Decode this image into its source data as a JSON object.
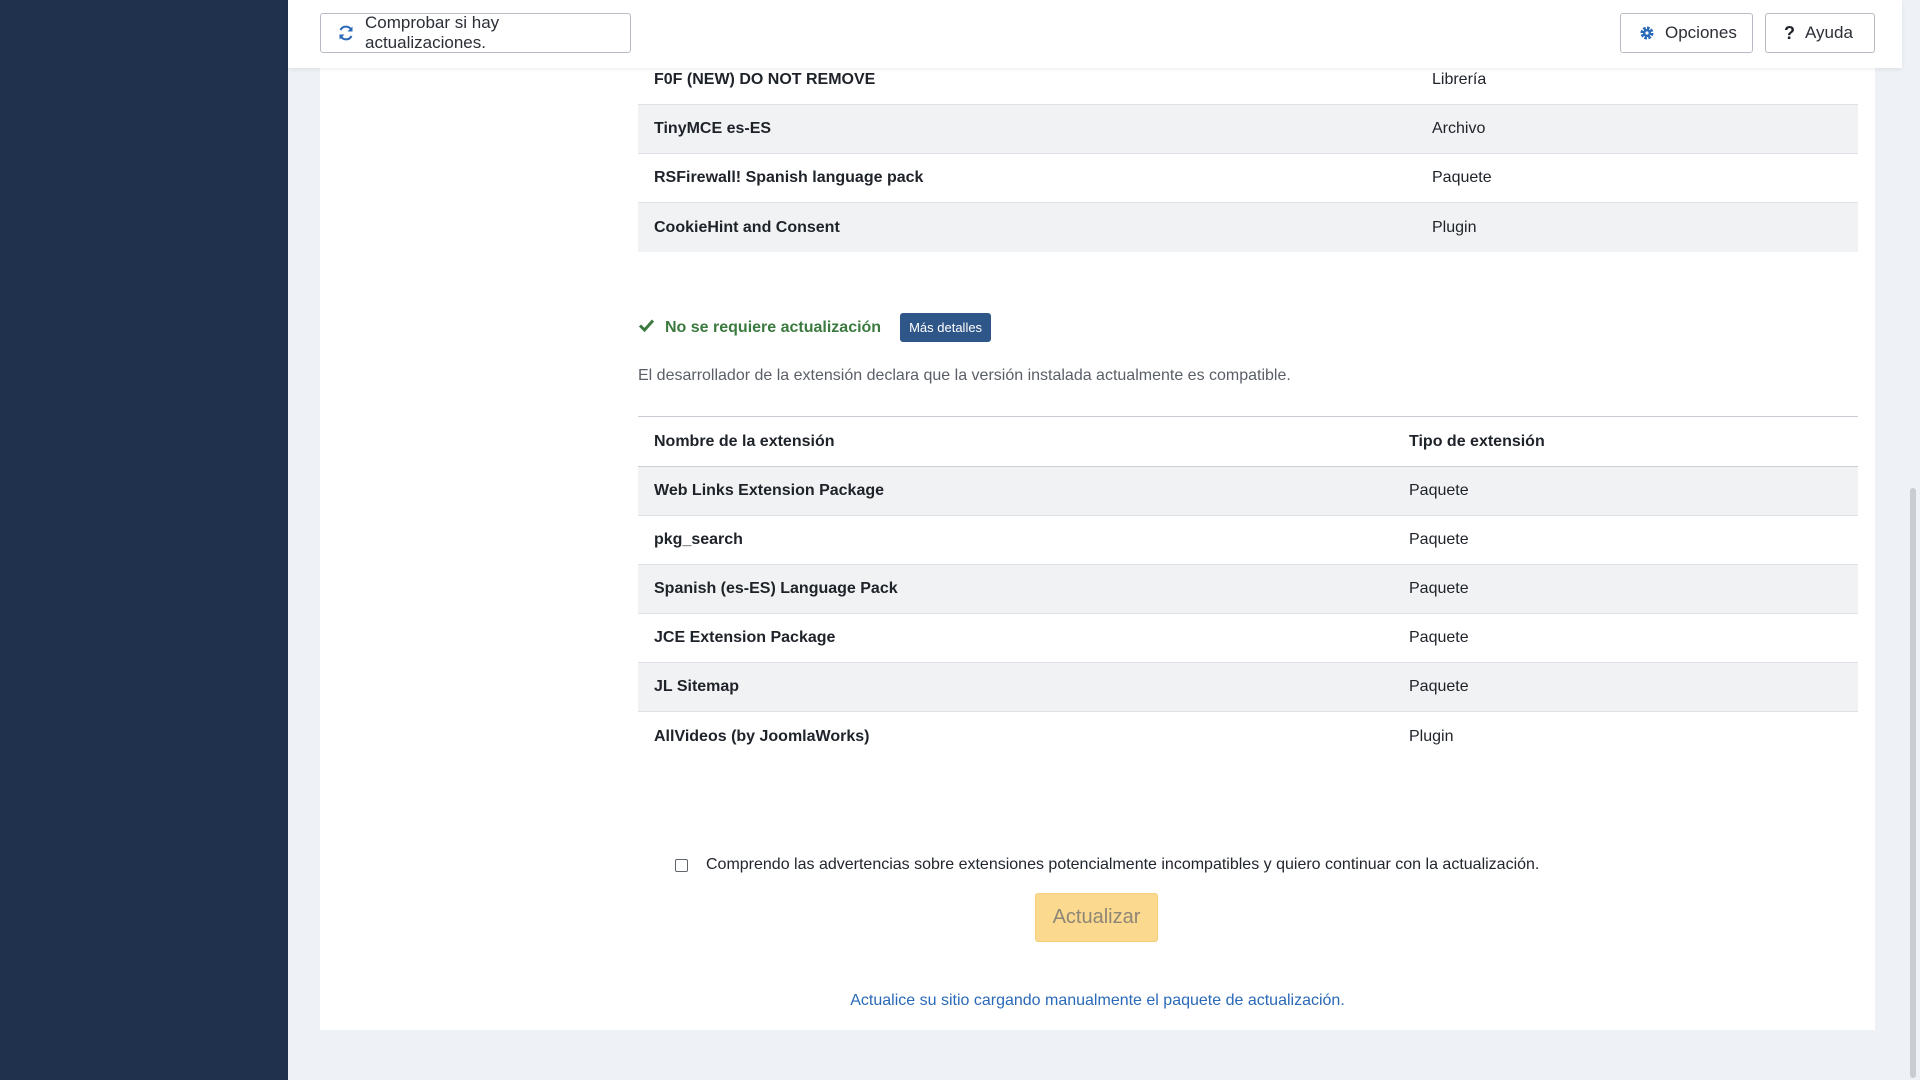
{
  "toolbar": {
    "check_updates_label": "Comprobar si hay actualizaciones.",
    "options_label": "Opciones",
    "help_label": "Ayuda"
  },
  "incompatible_table": {
    "rows": [
      {
        "name": "F0F (NEW) DO NOT REMOVE",
        "type": "Librería"
      },
      {
        "name": "TinyMCE es-ES",
        "type": "Archivo"
      },
      {
        "name": "RSFirewall! Spanish language pack",
        "type": "Paquete"
      },
      {
        "name": "CookieHint and Consent",
        "type": "Plugin"
      }
    ]
  },
  "no_update_section": {
    "status": "No se requiere actualización",
    "details_button": "Más detalles",
    "description": "El desarrollador de la extensión declara que la versión instalada actualmente es compatible.",
    "headers": {
      "name": "Nombre de la extensión",
      "type": "Tipo de extensión"
    },
    "rows": [
      {
        "name": "Web Links Extension Package",
        "type": "Paquete"
      },
      {
        "name": "pkg_search",
        "type": "Paquete"
      },
      {
        "name": "Spanish (es-ES) Language Pack",
        "type": "Paquete"
      },
      {
        "name": "JCE Extension Package",
        "type": "Paquete"
      },
      {
        "name": "JL Sitemap",
        "type": "Paquete"
      },
      {
        "name": "AllVideos (by JoomlaWorks)",
        "type": "Plugin"
      }
    ]
  },
  "confirm_label": "Comprendo las advertencias sobre extensiones potencialmente incompatibles y quiero continuar con la actualización.",
  "update_button": "Actualizar",
  "manual_link": "Actualice su sitio cargando manualmente el paquete de actualización.",
  "colors": {
    "sidebar": "#1f314d",
    "success": "#3b7a3f",
    "badge": "#2f5689",
    "update_button": "#fbd98e",
    "link": "#2a69b8"
  }
}
